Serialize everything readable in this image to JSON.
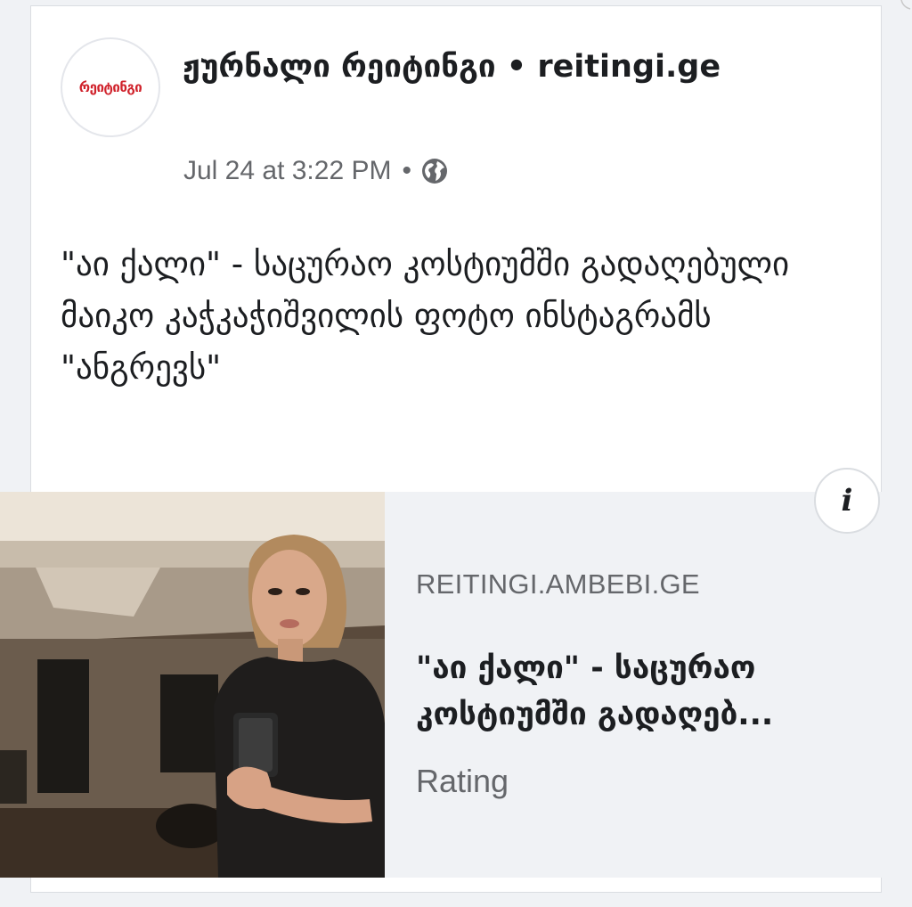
{
  "post": {
    "page_name": "ჟურნალი რეიტინგი • reitingi.ge",
    "avatar_logo_text": "რეიტინგი",
    "timestamp": "Jul 24 at 3:22 PM",
    "separator": "•",
    "privacy_icon": "globe-icon",
    "text": "\"აი ქალი\" - საცურაო კოსტიუმში გადაღებული მაიკო კაჭკაჭიშვილის ფოტო ინსტაგრამს \"ანგრევს\""
  },
  "link_preview": {
    "domain": "REITINGI.AMBEBI.GE",
    "title": "\"აი ქალი\" - საცურაო კოსტიუმში გადაღებ...",
    "description": "Rating",
    "info_button_label": "i"
  },
  "colors": {
    "brand_red": "#d0222b",
    "text_primary": "#1c1e21",
    "text_secondary": "#65676b",
    "preview_bg": "#f0f2f5"
  }
}
